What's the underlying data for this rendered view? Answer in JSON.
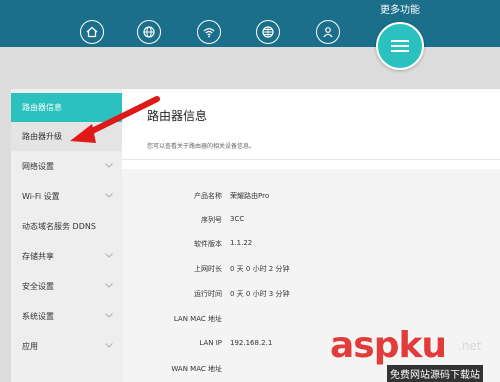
{
  "header": {
    "nav_icons": [
      "home-icon",
      "globe-icon",
      "wifi-icon",
      "network-globe-icon",
      "user-icon"
    ],
    "more_label": "更多功能",
    "menu_icon": "menu-icon",
    "colors": {
      "bar": "#1b6f8a",
      "accent": "#2ac1bf"
    }
  },
  "sidebar": {
    "items": [
      {
        "label": "路由器信息"
      },
      {
        "label": "路由器升级"
      },
      {
        "label": "网络设置"
      },
      {
        "label": "Wi-Fi 设置"
      },
      {
        "label": "动态域名服务 DDNS"
      },
      {
        "label": "存储共享"
      },
      {
        "label": "安全设置"
      },
      {
        "label": "系统设置"
      },
      {
        "label": "应用"
      }
    ]
  },
  "main": {
    "title": "路由器信息",
    "subtitle": "您可以查看关于路由器的相关设备信息。",
    "rows": [
      {
        "key": "产品名称",
        "value": "荣耀路由Pro"
      },
      {
        "key": "序列号",
        "value": "3CC"
      },
      {
        "key": "软件版本",
        "value": "1.1.22"
      },
      {
        "key": "上网时长",
        "value": "0 天 0 小时 2 分钟"
      },
      {
        "key": "运行时间",
        "value": "0 天 0 小时 3 分钟"
      },
      {
        "key": "LAN MAC 地址",
        "value": ""
      },
      {
        "key": "LAN IP",
        "value": "192.168.2.1"
      },
      {
        "key": "WAN MAC 地址",
        "value": ""
      }
    ]
  },
  "watermark": {
    "brand": "aspku",
    "net": ".net",
    "tagline": "免费网站源码下载站"
  }
}
